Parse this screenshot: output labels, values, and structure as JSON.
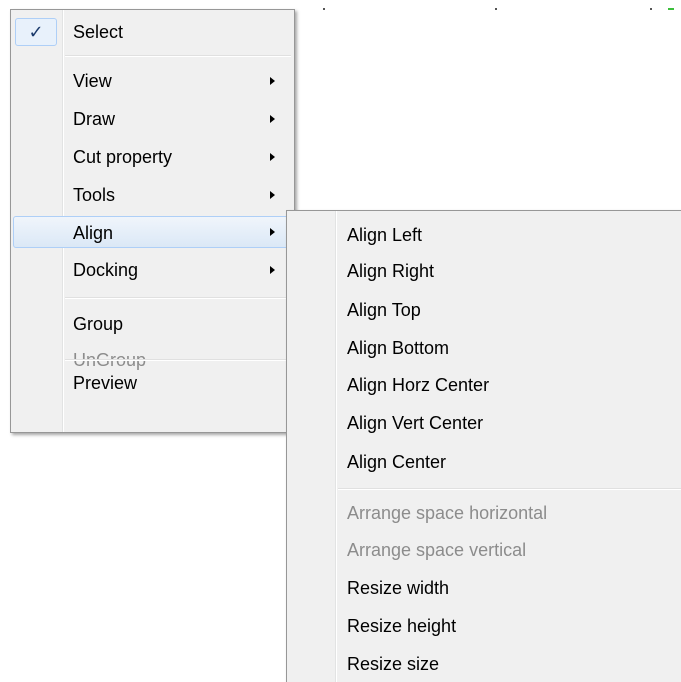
{
  "main_menu": {
    "items": [
      {
        "label": "Select",
        "checked": true,
        "check_glyph": "✓"
      },
      {
        "label": "View",
        "has_submenu": true
      },
      {
        "label": "Draw",
        "has_submenu": true
      },
      {
        "label": "Cut property",
        "has_submenu": true
      },
      {
        "label": "Tools",
        "has_submenu": true
      },
      {
        "label": "Align",
        "has_submenu": true,
        "highlighted": true
      },
      {
        "label": "Docking",
        "has_submenu": true
      },
      {
        "label": "Group"
      },
      {
        "label": "UnGroup",
        "disabled": true
      },
      {
        "label": "Preview"
      }
    ]
  },
  "align_submenu": {
    "items": [
      {
        "label": "Align Left"
      },
      {
        "label": "Align Right"
      },
      {
        "label": "Align Top"
      },
      {
        "label": "Align Bottom"
      },
      {
        "label": "Align Horz Center"
      },
      {
        "label": "Align Vert Center"
      },
      {
        "label": "Align Center"
      },
      {
        "label": "Arrange space horizontal",
        "disabled": true
      },
      {
        "label": "Arrange space vertical",
        "disabled": true
      },
      {
        "label": "Resize width"
      },
      {
        "label": "Resize height"
      },
      {
        "label": "Resize size"
      }
    ]
  },
  "colors": {
    "menu_background": "#f0f0f0",
    "highlight_border": "#aecff7",
    "disabled_text": "#8c8c8c"
  }
}
